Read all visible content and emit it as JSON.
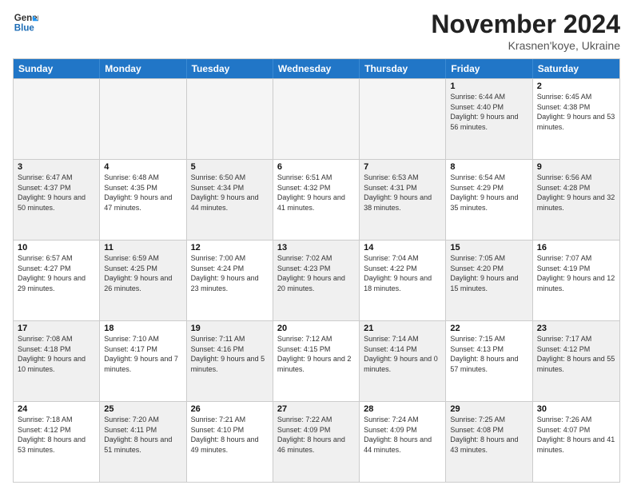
{
  "header": {
    "logo_line1": "General",
    "logo_line2": "Blue",
    "month_title": "November 2024",
    "location": "Krasnen'koye, Ukraine"
  },
  "weekdays": [
    "Sunday",
    "Monday",
    "Tuesday",
    "Wednesday",
    "Thursday",
    "Friday",
    "Saturday"
  ],
  "rows": [
    [
      {
        "day": "",
        "info": "",
        "empty": true
      },
      {
        "day": "",
        "info": "",
        "empty": true
      },
      {
        "day": "",
        "info": "",
        "empty": true
      },
      {
        "day": "",
        "info": "",
        "empty": true
      },
      {
        "day": "",
        "info": "",
        "empty": true
      },
      {
        "day": "1",
        "info": "Sunrise: 6:44 AM\nSunset: 4:40 PM\nDaylight: 9 hours and 56 minutes.",
        "shaded": true
      },
      {
        "day": "2",
        "info": "Sunrise: 6:45 AM\nSunset: 4:38 PM\nDaylight: 9 hours and 53 minutes.",
        "shaded": false
      }
    ],
    [
      {
        "day": "3",
        "info": "Sunrise: 6:47 AM\nSunset: 4:37 PM\nDaylight: 9 hours and 50 minutes.",
        "shaded": true
      },
      {
        "day": "4",
        "info": "Sunrise: 6:48 AM\nSunset: 4:35 PM\nDaylight: 9 hours and 47 minutes.",
        "shaded": false
      },
      {
        "day": "5",
        "info": "Sunrise: 6:50 AM\nSunset: 4:34 PM\nDaylight: 9 hours and 44 minutes.",
        "shaded": true
      },
      {
        "day": "6",
        "info": "Sunrise: 6:51 AM\nSunset: 4:32 PM\nDaylight: 9 hours and 41 minutes.",
        "shaded": false
      },
      {
        "day": "7",
        "info": "Sunrise: 6:53 AM\nSunset: 4:31 PM\nDaylight: 9 hours and 38 minutes.",
        "shaded": true
      },
      {
        "day": "8",
        "info": "Sunrise: 6:54 AM\nSunset: 4:29 PM\nDaylight: 9 hours and 35 minutes.",
        "shaded": false
      },
      {
        "day": "9",
        "info": "Sunrise: 6:56 AM\nSunset: 4:28 PM\nDaylight: 9 hours and 32 minutes.",
        "shaded": true
      }
    ],
    [
      {
        "day": "10",
        "info": "Sunrise: 6:57 AM\nSunset: 4:27 PM\nDaylight: 9 hours and 29 minutes.",
        "shaded": false
      },
      {
        "day": "11",
        "info": "Sunrise: 6:59 AM\nSunset: 4:25 PM\nDaylight: 9 hours and 26 minutes.",
        "shaded": true
      },
      {
        "day": "12",
        "info": "Sunrise: 7:00 AM\nSunset: 4:24 PM\nDaylight: 9 hours and 23 minutes.",
        "shaded": false
      },
      {
        "day": "13",
        "info": "Sunrise: 7:02 AM\nSunset: 4:23 PM\nDaylight: 9 hours and 20 minutes.",
        "shaded": true
      },
      {
        "day": "14",
        "info": "Sunrise: 7:04 AM\nSunset: 4:22 PM\nDaylight: 9 hours and 18 minutes.",
        "shaded": false
      },
      {
        "day": "15",
        "info": "Sunrise: 7:05 AM\nSunset: 4:20 PM\nDaylight: 9 hours and 15 minutes.",
        "shaded": true
      },
      {
        "day": "16",
        "info": "Sunrise: 7:07 AM\nSunset: 4:19 PM\nDaylight: 9 hours and 12 minutes.",
        "shaded": false
      }
    ],
    [
      {
        "day": "17",
        "info": "Sunrise: 7:08 AM\nSunset: 4:18 PM\nDaylight: 9 hours and 10 minutes.",
        "shaded": true
      },
      {
        "day": "18",
        "info": "Sunrise: 7:10 AM\nSunset: 4:17 PM\nDaylight: 9 hours and 7 minutes.",
        "shaded": false
      },
      {
        "day": "19",
        "info": "Sunrise: 7:11 AM\nSunset: 4:16 PM\nDaylight: 9 hours and 5 minutes.",
        "shaded": true
      },
      {
        "day": "20",
        "info": "Sunrise: 7:12 AM\nSunset: 4:15 PM\nDaylight: 9 hours and 2 minutes.",
        "shaded": false
      },
      {
        "day": "21",
        "info": "Sunrise: 7:14 AM\nSunset: 4:14 PM\nDaylight: 9 hours and 0 minutes.",
        "shaded": true
      },
      {
        "day": "22",
        "info": "Sunrise: 7:15 AM\nSunset: 4:13 PM\nDaylight: 8 hours and 57 minutes.",
        "shaded": false
      },
      {
        "day": "23",
        "info": "Sunrise: 7:17 AM\nSunset: 4:12 PM\nDaylight: 8 hours and 55 minutes.",
        "shaded": true
      }
    ],
    [
      {
        "day": "24",
        "info": "Sunrise: 7:18 AM\nSunset: 4:12 PM\nDaylight: 8 hours and 53 minutes.",
        "shaded": false
      },
      {
        "day": "25",
        "info": "Sunrise: 7:20 AM\nSunset: 4:11 PM\nDaylight: 8 hours and 51 minutes.",
        "shaded": true
      },
      {
        "day": "26",
        "info": "Sunrise: 7:21 AM\nSunset: 4:10 PM\nDaylight: 8 hours and 49 minutes.",
        "shaded": false
      },
      {
        "day": "27",
        "info": "Sunrise: 7:22 AM\nSunset: 4:09 PM\nDaylight: 8 hours and 46 minutes.",
        "shaded": true
      },
      {
        "day": "28",
        "info": "Sunrise: 7:24 AM\nSunset: 4:09 PM\nDaylight: 8 hours and 44 minutes.",
        "shaded": false
      },
      {
        "day": "29",
        "info": "Sunrise: 7:25 AM\nSunset: 4:08 PM\nDaylight: 8 hours and 43 minutes.",
        "shaded": true
      },
      {
        "day": "30",
        "info": "Sunrise: 7:26 AM\nSunset: 4:07 PM\nDaylight: 8 hours and 41 minutes.",
        "shaded": false
      }
    ]
  ]
}
